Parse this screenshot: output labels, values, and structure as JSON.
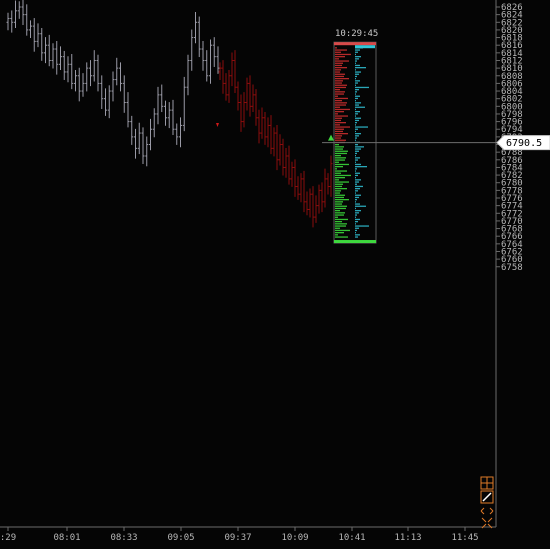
{
  "chart_data": {
    "type": "ohlc",
    "title": "",
    "price_axis": {
      "min": 6757,
      "max": 6827,
      "tick_labels": [
        "6826",
        "6824",
        "6822",
        "6820",
        "6818",
        "6816",
        "6814",
        "6812",
        "6810",
        "6808",
        "6806",
        "6804",
        "6802",
        "6800",
        "6798",
        "6796",
        "6794",
        "6792",
        "6790",
        "6788",
        "6786",
        "6784",
        "6782",
        "6780",
        "6778",
        "6776",
        "6774",
        "6772",
        "6770",
        "6768",
        "6766",
        "6764",
        "6762",
        "6760",
        "6758"
      ]
    },
    "time_axis": {
      "tick_labels": [
        ":29",
        "08:01",
        "08:33",
        "09:05",
        "09:37",
        "10:09",
        "10:41",
        "11:13",
        "11:45"
      ]
    },
    "current_price": {
      "value": 6790.5,
      "label": "6790.5"
    },
    "volume_profile": {
      "time_label": "10:29:45",
      "price_low": 6765,
      "price_high": 6816
    },
    "series": [
      {
        "name": "",
        "color": "#9a9aa6",
        "closes": [
          6823,
          6822,
          6825,
          6826,
          6824,
          6820,
          6821,
          6817,
          6819,
          6814,
          6816,
          6812,
          6815,
          6811,
          6813,
          6809,
          6811,
          6806,
          6808,
          6804,
          6806,
          6810,
          6808,
          6812,
          6806,
          6802,
          6799,
          6804,
          6807,
          6810,
          6806,
          6801,
          6796,
          6792,
          6789,
          6793,
          6787,
          6790,
          6794,
          6798,
          6803,
          6800,
          6797,
          6799,
          6794,
          6792,
          6795,
          6805,
          6812,
          6818,
          6822,
          6815,
          6812,
          6808,
          6816,
          6813,
          6810
        ]
      },
      {
        "name": "",
        "color": "#8b0d0d",
        "closes": [
          6810,
          6806,
          6803,
          6808,
          6812,
          6805,
          6801,
          6796,
          6801,
          6806,
          6800,
          6803,
          6797,
          6793,
          6797,
          6792,
          6795,
          6789,
          6793,
          6786,
          6790,
          6784,
          6787,
          6781,
          6784,
          6779,
          6777,
          6781,
          6775,
          6773,
          6777,
          6771,
          6774,
          6778,
          6775,
          6781,
          6779,
          6785
        ]
      }
    ]
  },
  "toolbar": {
    "icons": [
      "crosshair-grid-icon",
      "pencil-draw-icon",
      "expand-arrows-icon",
      "collapse-arrows-icon"
    ]
  }
}
